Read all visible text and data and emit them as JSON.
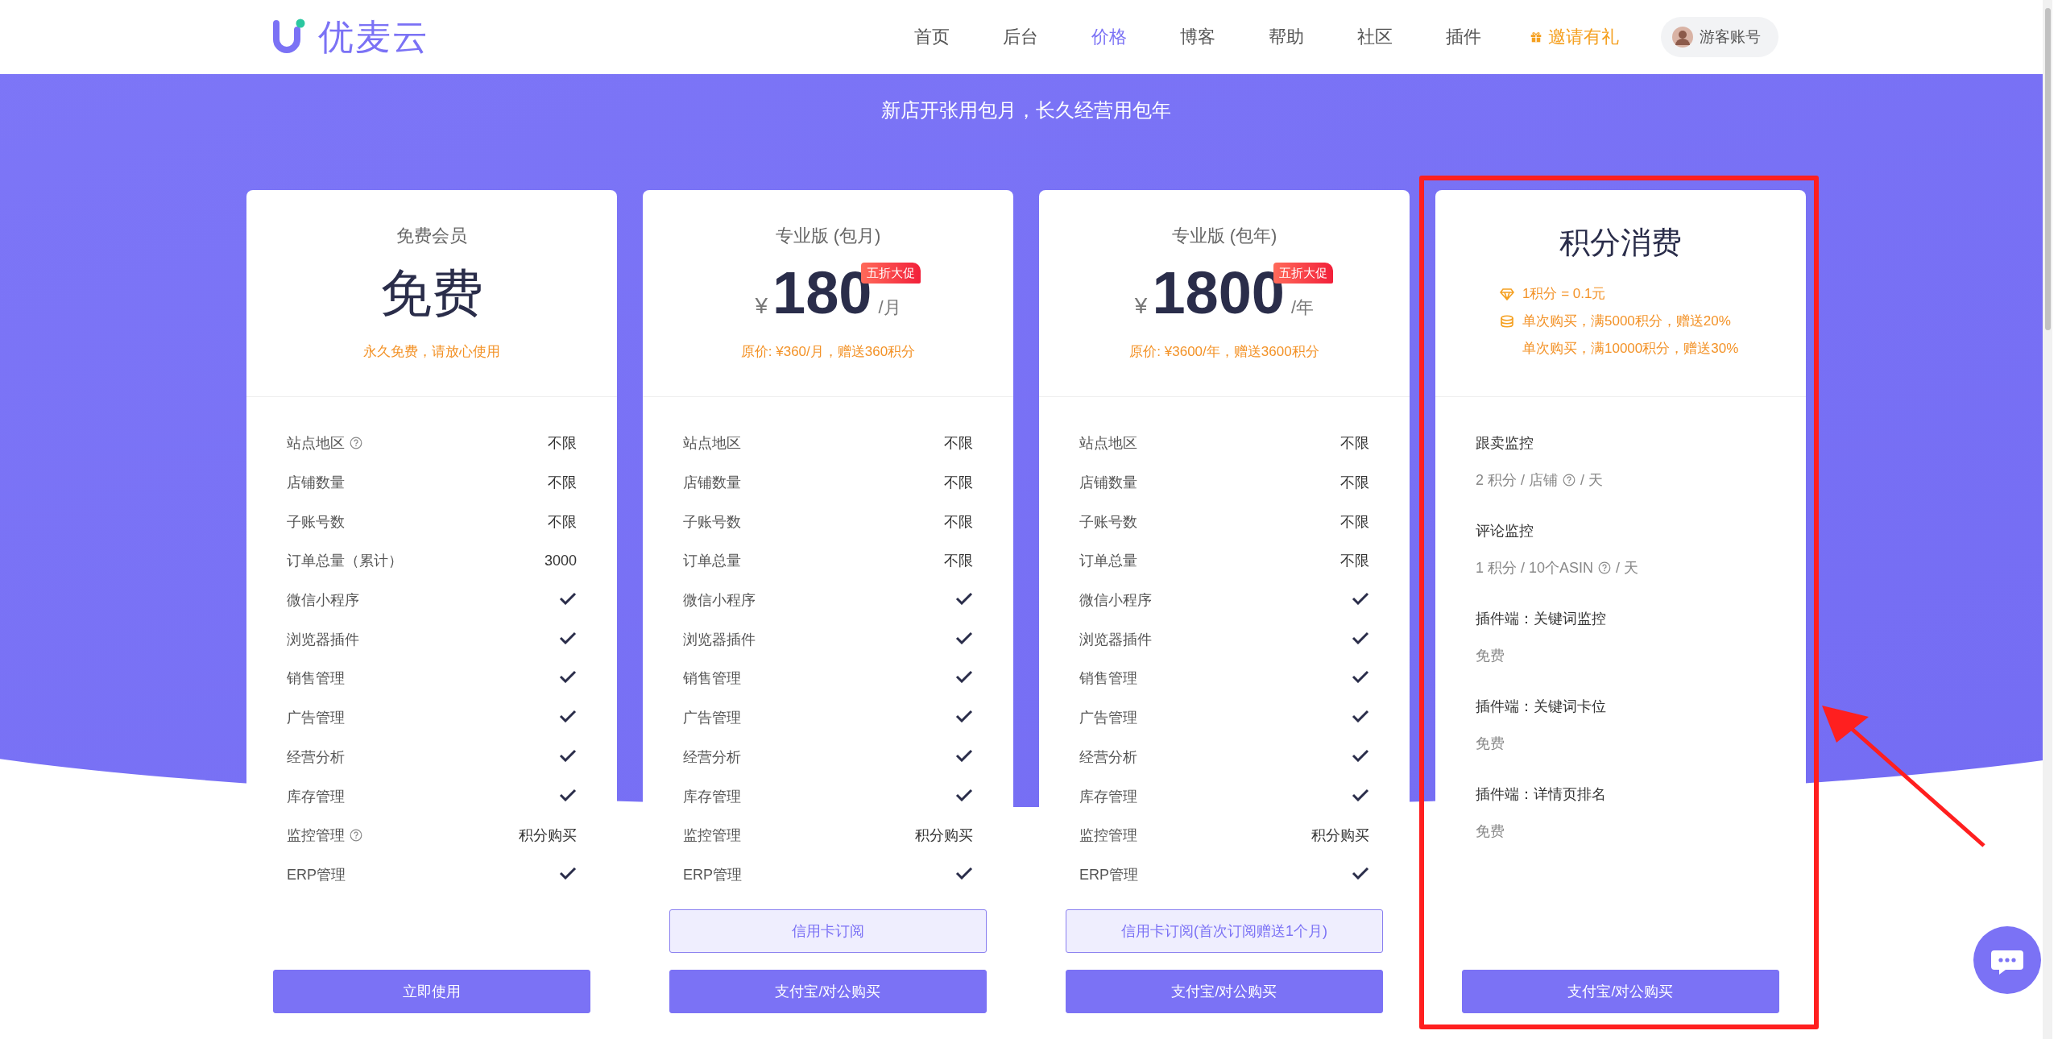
{
  "header": {
    "brand": "优麦云",
    "nav": [
      {
        "label": "首页",
        "selected": false
      },
      {
        "label": "后台",
        "selected": false
      },
      {
        "label": "价格",
        "selected": true
      },
      {
        "label": "博客",
        "selected": false
      },
      {
        "label": "帮助",
        "selected": false
      },
      {
        "label": "社区",
        "selected": false
      },
      {
        "label": "插件",
        "selected": false
      }
    ],
    "invite": "邀请有礼",
    "account": "游客账号"
  },
  "hero": {
    "tagline": "新店开张用包月，长久经营用包年"
  },
  "plans": [
    {
      "kind": "free",
      "title": "免费会员",
      "headline": "免费",
      "note": "永久免费，请放心使用",
      "features": [
        {
          "label": "站点地区",
          "help": true,
          "kind": "text",
          "value": "不限"
        },
        {
          "label": "店铺数量",
          "help": false,
          "kind": "text",
          "value": "不限"
        },
        {
          "label": "子账号数",
          "help": false,
          "kind": "text",
          "value": "不限"
        },
        {
          "label": "订单总量（累计）",
          "help": false,
          "kind": "text",
          "value": "3000"
        },
        {
          "label": "微信小程序",
          "help": false,
          "kind": "check"
        },
        {
          "label": "浏览器插件",
          "help": false,
          "kind": "check"
        },
        {
          "label": "销售管理",
          "help": false,
          "kind": "check"
        },
        {
          "label": "广告管理",
          "help": false,
          "kind": "check"
        },
        {
          "label": "经营分析",
          "help": false,
          "kind": "check"
        },
        {
          "label": "库存管理",
          "help": false,
          "kind": "check"
        },
        {
          "label": "监控管理",
          "help": true,
          "kind": "text",
          "value": "积分购买"
        },
        {
          "label": "ERP管理",
          "help": false,
          "kind": "check"
        }
      ],
      "buttons": [
        {
          "label": "立即使用",
          "kind": "primary"
        }
      ]
    },
    {
      "kind": "paid",
      "title": "专业版 (包月)",
      "currency": "¥",
      "amount": "180",
      "period": "/月",
      "badge": "五折大促",
      "note": "原价: ¥360/月，赠送360积分",
      "features": [
        {
          "label": "站点地区",
          "help": false,
          "kind": "text",
          "value": "不限"
        },
        {
          "label": "店铺数量",
          "help": false,
          "kind": "text",
          "value": "不限"
        },
        {
          "label": "子账号数",
          "help": false,
          "kind": "text",
          "value": "不限"
        },
        {
          "label": "订单总量",
          "help": false,
          "kind": "text",
          "value": "不限"
        },
        {
          "label": "微信小程序",
          "help": false,
          "kind": "check"
        },
        {
          "label": "浏览器插件",
          "help": false,
          "kind": "check"
        },
        {
          "label": "销售管理",
          "help": false,
          "kind": "check"
        },
        {
          "label": "广告管理",
          "help": false,
          "kind": "check"
        },
        {
          "label": "经营分析",
          "help": false,
          "kind": "check"
        },
        {
          "label": "库存管理",
          "help": false,
          "kind": "check"
        },
        {
          "label": "监控管理",
          "help": false,
          "kind": "text",
          "value": "积分购买"
        },
        {
          "label": "ERP管理",
          "help": false,
          "kind": "check"
        }
      ],
      "buttons": [
        {
          "label": "信用卡订阅",
          "kind": "outline"
        },
        {
          "label": "支付宝/对公购买",
          "kind": "primary"
        }
      ]
    },
    {
      "kind": "paid",
      "title": "专业版 (包年)",
      "currency": "¥",
      "amount": "1800",
      "period": "/年",
      "badge": "五折大促",
      "note": "原价: ¥3600/年，赠送3600积分",
      "features": [
        {
          "label": "站点地区",
          "help": false,
          "kind": "text",
          "value": "不限"
        },
        {
          "label": "店铺数量",
          "help": false,
          "kind": "text",
          "value": "不限"
        },
        {
          "label": "子账号数",
          "help": false,
          "kind": "text",
          "value": "不限"
        },
        {
          "label": "订单总量",
          "help": false,
          "kind": "text",
          "value": "不限"
        },
        {
          "label": "微信小程序",
          "help": false,
          "kind": "check"
        },
        {
          "label": "浏览器插件",
          "help": false,
          "kind": "check"
        },
        {
          "label": "销售管理",
          "help": false,
          "kind": "check"
        },
        {
          "label": "广告管理",
          "help": false,
          "kind": "check"
        },
        {
          "label": "经营分析",
          "help": false,
          "kind": "check"
        },
        {
          "label": "库存管理",
          "help": false,
          "kind": "check"
        },
        {
          "label": "监控管理",
          "help": false,
          "kind": "text",
          "value": "积分购买"
        },
        {
          "label": "ERP管理",
          "help": false,
          "kind": "check"
        }
      ],
      "buttons": [
        {
          "label": "信用卡订阅(首次订阅赠送1个月)",
          "kind": "outline"
        },
        {
          "label": "支付宝/对公购买",
          "kind": "primary"
        }
      ]
    },
    {
      "kind": "points",
      "title": "积分消费",
      "rules": [
        {
          "kind": "rate",
          "text": "1积分 = 0.1元"
        },
        {
          "kind": "bonus",
          "text": "单次购买，满5000积分，赠送20%"
        },
        {
          "kind": "plain",
          "text": "单次购买，满10000积分，赠送30%"
        }
      ],
      "items": [
        {
          "title": "跟卖监控",
          "price": "2 积分 / 店铺",
          "help": true,
          "price_suffix": "/ 天"
        },
        {
          "title": "评论监控",
          "price": "1 积分 / 10个ASIN",
          "help": true,
          "price_suffix": "/ 天"
        },
        {
          "title": "插件端：关键词监控",
          "price": "免费",
          "help": false
        },
        {
          "title": "插件端：关键词卡位",
          "price": "免费",
          "help": false
        },
        {
          "title": "插件端：详情页排名",
          "price": "免费",
          "help": false
        }
      ],
      "buttons": [
        {
          "label": "支付宝/对公购买",
          "kind": "primary"
        }
      ]
    }
  ]
}
